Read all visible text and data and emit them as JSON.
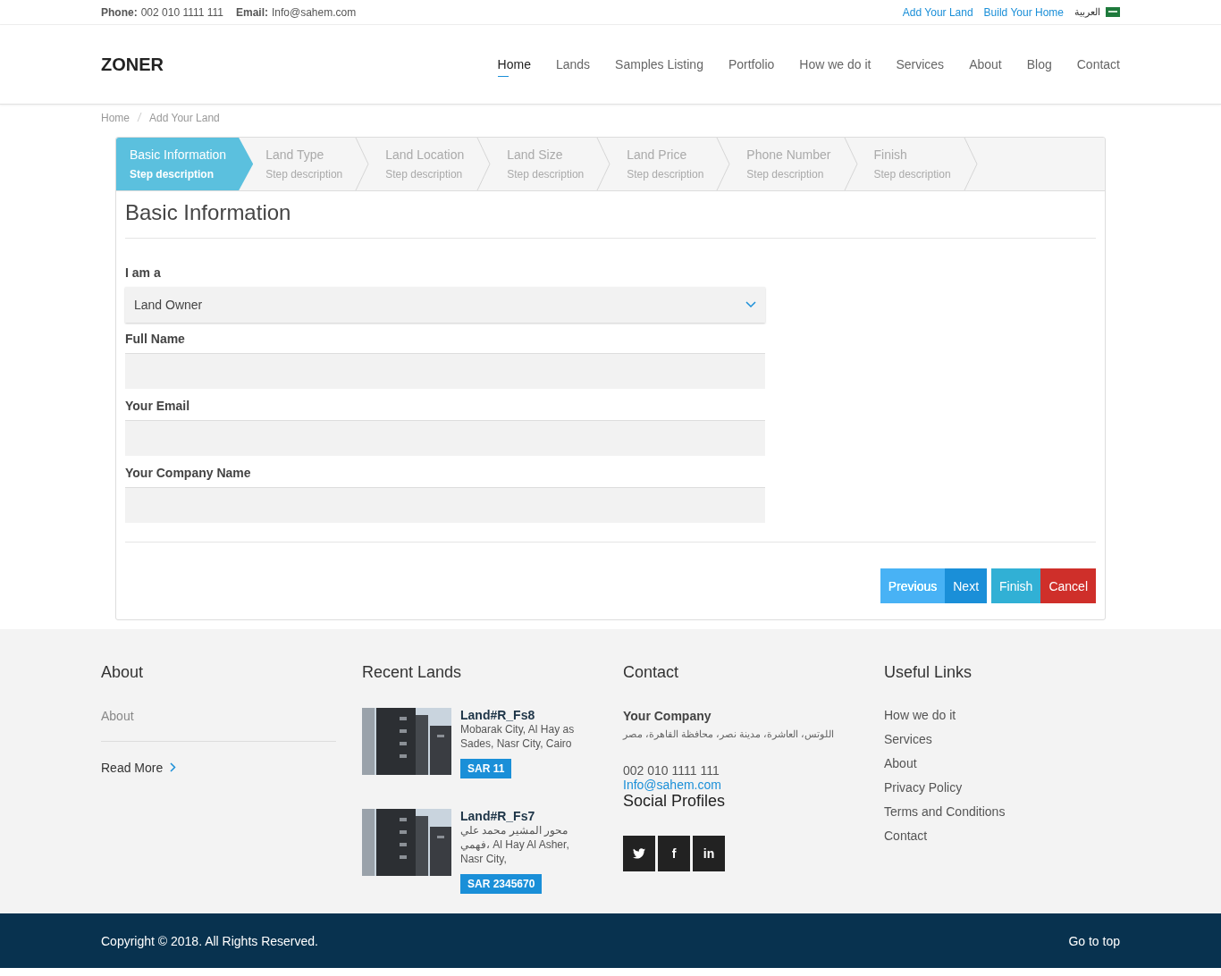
{
  "topbar": {
    "phone_label": "Phone:",
    "phone": "002 010 1111 111",
    "email_label": "Email:",
    "email": "Info@sahem.com",
    "links": [
      "Add Your Land",
      "Build Your Home"
    ],
    "language": "العربية"
  },
  "header": {
    "logo": "ZONER",
    "nav": [
      {
        "label": "Home",
        "selected": true
      },
      {
        "label": "Lands",
        "selected": false
      },
      {
        "label": "Samples Listing",
        "selected": false
      },
      {
        "label": "Portfolio",
        "selected": false
      },
      {
        "label": "How we do it",
        "selected": false
      },
      {
        "label": "Services",
        "selected": false
      },
      {
        "label": "About",
        "selected": false
      },
      {
        "label": "Blog",
        "selected": false
      },
      {
        "label": "Contact",
        "selected": false
      }
    ]
  },
  "breadcrumb": [
    "Home",
    "Add Your Land"
  ],
  "wizard": {
    "steps": [
      {
        "title": "Basic Information",
        "description": "Step description",
        "selected": true
      },
      {
        "title": "Land Type",
        "description": "Step description",
        "selected": false
      },
      {
        "title": "Land Location",
        "description": "Step description",
        "selected": false
      },
      {
        "title": "Land Size",
        "description": "Step description",
        "selected": false
      },
      {
        "title": "Land Price",
        "description": "Step description",
        "selected": false
      },
      {
        "title": "Phone Number",
        "description": "Step description",
        "selected": false
      },
      {
        "title": "Finish",
        "description": "Step description",
        "selected": false
      }
    ],
    "heading": "Basic Information",
    "fields": [
      {
        "kind": "select",
        "label": "I am a",
        "value": "Land Owner"
      },
      {
        "kind": "text",
        "label": "Full Name"
      },
      {
        "kind": "text",
        "label": "Your Email"
      },
      {
        "kind": "text",
        "label": "Your Company Name"
      }
    ],
    "buttons": [
      {
        "label": "Previous",
        "kind": "previous",
        "disabled": true
      },
      {
        "label": "Next",
        "kind": "next",
        "disabled": false
      },
      {
        "label": "Finish",
        "kind": "finish",
        "disabled": false
      },
      {
        "label": "Cancel",
        "kind": "cancel",
        "disabled": false
      }
    ]
  },
  "footer": {
    "about": {
      "title": "About",
      "text": "About",
      "read_more": "Read More"
    },
    "recent": {
      "title": "Recent Lands",
      "items": [
        {
          "name": "Land#R_Fs8",
          "address": "Mobarak City, Al Hay as Sades, Nasr City, Cairo",
          "price": "SAR 11"
        },
        {
          "name": "Land#R_Fs7",
          "address": "محور المشير محمد علي فهمي، Al Hay Al Asher, Nasr City,",
          "price": "SAR 2345670"
        }
      ]
    },
    "contact": {
      "title": "Contact",
      "company": "Your Company",
      "address": "اللوتس، العاشرة، مدينة نصر، محافظة القاهرة، مصر",
      "phone": "002 010 1111 111",
      "email": "Info@sahem.com",
      "social_title": "Social Profiles",
      "social": [
        {
          "kind": "twitter"
        },
        {
          "kind": "text",
          "label": "f"
        },
        {
          "kind": "text",
          "label": "in"
        }
      ]
    },
    "links": {
      "title": "Useful Links",
      "items": [
        "How we do it",
        "Services",
        "About",
        "Privacy Policy",
        "Terms and Conditions",
        "Contact"
      ]
    }
  },
  "bottom": {
    "copyright": "Copyright © 2018. All Rights Reserved.",
    "top_link": "Go to top"
  }
}
